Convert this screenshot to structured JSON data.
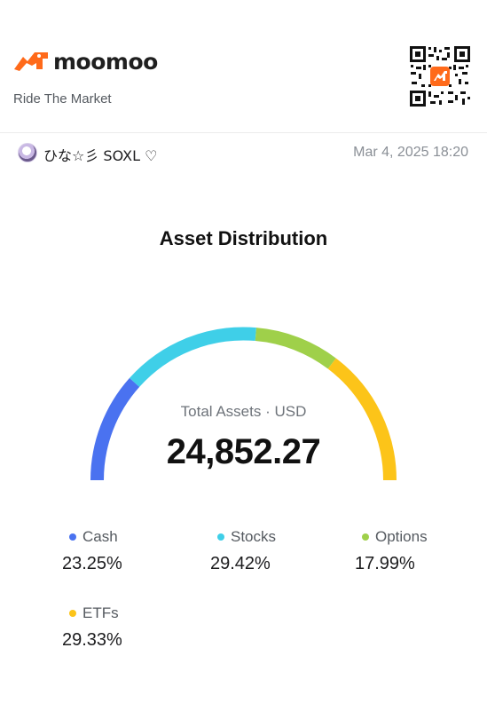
{
  "brand": {
    "name": "moomoo",
    "tagline": "Ride The Market",
    "accent_color": "#ff6a1a"
  },
  "qr_icon": "qr-code-icon",
  "post": {
    "username": "ひな☆彡 SOXL ♡",
    "timestamp": "Mar 4, 2025 18:20"
  },
  "section": {
    "title": "Asset Distribution"
  },
  "total": {
    "label": "Total Assets · USD",
    "value": "24,852.27"
  },
  "chart_data": {
    "type": "pie",
    "title": "Asset Distribution",
    "series": [
      {
        "name": "Cash",
        "value": 23.25,
        "label": "23.25%",
        "color": "#4a72f0"
      },
      {
        "name": "Stocks",
        "value": 29.42,
        "label": "29.42%",
        "color": "#3fcfe8"
      },
      {
        "name": "Options",
        "value": 17.99,
        "label": "17.99%",
        "color": "#9fd04a"
      },
      {
        "name": "ETFs",
        "value": 29.33,
        "label": "29.33%",
        "color": "#fcc419"
      }
    ]
  }
}
